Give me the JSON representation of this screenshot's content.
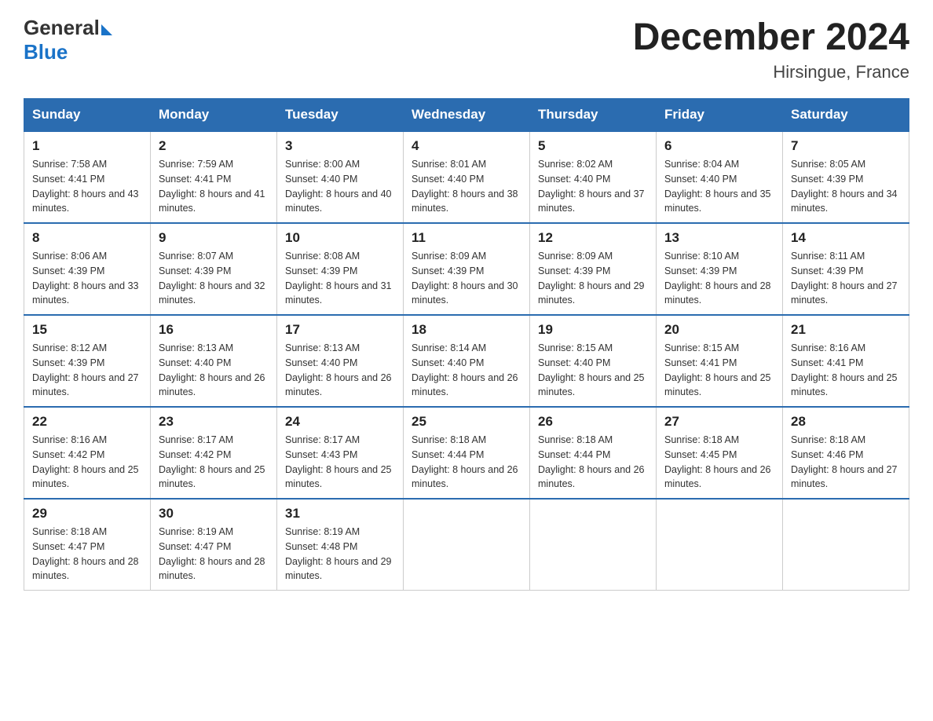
{
  "header": {
    "logo_general": "General",
    "logo_blue": "Blue",
    "title": "December 2024",
    "subtitle": "Hirsingue, France"
  },
  "days_of_week": [
    "Sunday",
    "Monday",
    "Tuesday",
    "Wednesday",
    "Thursday",
    "Friday",
    "Saturday"
  ],
  "weeks": [
    [
      {
        "day": "1",
        "sunrise": "7:58 AM",
        "sunset": "4:41 PM",
        "daylight": "8 hours and 43 minutes."
      },
      {
        "day": "2",
        "sunrise": "7:59 AM",
        "sunset": "4:41 PM",
        "daylight": "8 hours and 41 minutes."
      },
      {
        "day": "3",
        "sunrise": "8:00 AM",
        "sunset": "4:40 PM",
        "daylight": "8 hours and 40 minutes."
      },
      {
        "day": "4",
        "sunrise": "8:01 AM",
        "sunset": "4:40 PM",
        "daylight": "8 hours and 38 minutes."
      },
      {
        "day": "5",
        "sunrise": "8:02 AM",
        "sunset": "4:40 PM",
        "daylight": "8 hours and 37 minutes."
      },
      {
        "day": "6",
        "sunrise": "8:04 AM",
        "sunset": "4:40 PM",
        "daylight": "8 hours and 35 minutes."
      },
      {
        "day": "7",
        "sunrise": "8:05 AM",
        "sunset": "4:39 PM",
        "daylight": "8 hours and 34 minutes."
      }
    ],
    [
      {
        "day": "8",
        "sunrise": "8:06 AM",
        "sunset": "4:39 PM",
        "daylight": "8 hours and 33 minutes."
      },
      {
        "day": "9",
        "sunrise": "8:07 AM",
        "sunset": "4:39 PM",
        "daylight": "8 hours and 32 minutes."
      },
      {
        "day": "10",
        "sunrise": "8:08 AM",
        "sunset": "4:39 PM",
        "daylight": "8 hours and 31 minutes."
      },
      {
        "day": "11",
        "sunrise": "8:09 AM",
        "sunset": "4:39 PM",
        "daylight": "8 hours and 30 minutes."
      },
      {
        "day": "12",
        "sunrise": "8:09 AM",
        "sunset": "4:39 PM",
        "daylight": "8 hours and 29 minutes."
      },
      {
        "day": "13",
        "sunrise": "8:10 AM",
        "sunset": "4:39 PM",
        "daylight": "8 hours and 28 minutes."
      },
      {
        "day": "14",
        "sunrise": "8:11 AM",
        "sunset": "4:39 PM",
        "daylight": "8 hours and 27 minutes."
      }
    ],
    [
      {
        "day": "15",
        "sunrise": "8:12 AM",
        "sunset": "4:39 PM",
        "daylight": "8 hours and 27 minutes."
      },
      {
        "day": "16",
        "sunrise": "8:13 AM",
        "sunset": "4:40 PM",
        "daylight": "8 hours and 26 minutes."
      },
      {
        "day": "17",
        "sunrise": "8:13 AM",
        "sunset": "4:40 PM",
        "daylight": "8 hours and 26 minutes."
      },
      {
        "day": "18",
        "sunrise": "8:14 AM",
        "sunset": "4:40 PM",
        "daylight": "8 hours and 26 minutes."
      },
      {
        "day": "19",
        "sunrise": "8:15 AM",
        "sunset": "4:40 PM",
        "daylight": "8 hours and 25 minutes."
      },
      {
        "day": "20",
        "sunrise": "8:15 AM",
        "sunset": "4:41 PM",
        "daylight": "8 hours and 25 minutes."
      },
      {
        "day": "21",
        "sunrise": "8:16 AM",
        "sunset": "4:41 PM",
        "daylight": "8 hours and 25 minutes."
      }
    ],
    [
      {
        "day": "22",
        "sunrise": "8:16 AM",
        "sunset": "4:42 PM",
        "daylight": "8 hours and 25 minutes."
      },
      {
        "day": "23",
        "sunrise": "8:17 AM",
        "sunset": "4:42 PM",
        "daylight": "8 hours and 25 minutes."
      },
      {
        "day": "24",
        "sunrise": "8:17 AM",
        "sunset": "4:43 PM",
        "daylight": "8 hours and 25 minutes."
      },
      {
        "day": "25",
        "sunrise": "8:18 AM",
        "sunset": "4:44 PM",
        "daylight": "8 hours and 26 minutes."
      },
      {
        "day": "26",
        "sunrise": "8:18 AM",
        "sunset": "4:44 PM",
        "daylight": "8 hours and 26 minutes."
      },
      {
        "day": "27",
        "sunrise": "8:18 AM",
        "sunset": "4:45 PM",
        "daylight": "8 hours and 26 minutes."
      },
      {
        "day": "28",
        "sunrise": "8:18 AM",
        "sunset": "4:46 PM",
        "daylight": "8 hours and 27 minutes."
      }
    ],
    [
      {
        "day": "29",
        "sunrise": "8:18 AM",
        "sunset": "4:47 PM",
        "daylight": "8 hours and 28 minutes."
      },
      {
        "day": "30",
        "sunrise": "8:19 AM",
        "sunset": "4:47 PM",
        "daylight": "8 hours and 28 minutes."
      },
      {
        "day": "31",
        "sunrise": "8:19 AM",
        "sunset": "4:48 PM",
        "daylight": "8 hours and 29 minutes."
      },
      null,
      null,
      null,
      null
    ]
  ]
}
